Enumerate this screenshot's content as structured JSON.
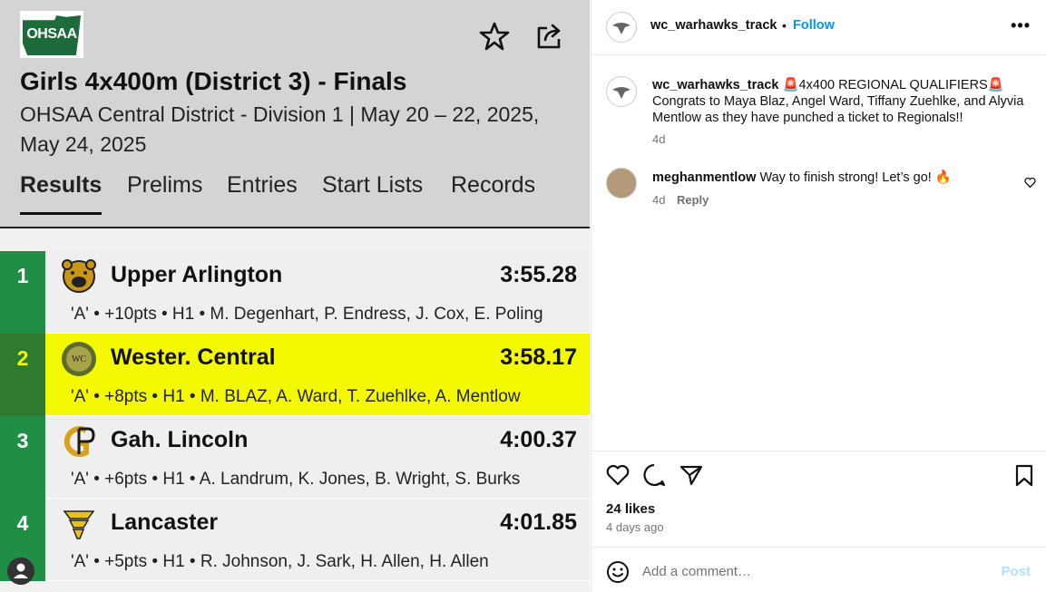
{
  "left": {
    "logo_text": "OHSAA",
    "title": "Girls 4x400m (District 3) - Finals",
    "subtitle": "OHSAA Central District - Division 1 | May 20 – 22, 2025, May 24, 2025",
    "tabs": [
      {
        "label": "Results",
        "active": true
      },
      {
        "label": "Prelims",
        "active": false
      },
      {
        "label": "Entries",
        "active": false
      },
      {
        "label": "Start Lists",
        "active": false
      },
      {
        "label": "Records",
        "active": false
      }
    ],
    "results": [
      {
        "place": "1",
        "team": "Upper Arlington",
        "time": "3:55.28",
        "detail": "'A' • +10pts • H1 • M. Degenhart, P. Endress, J. Cox, E. Poling"
      },
      {
        "place": "2",
        "team": "Wester. Central",
        "time": "3:58.17",
        "detail": "'A' • +8pts • H1 • M. BLAZ, A. Ward, T. Zuehlke, A. Mentlow",
        "highlighted": true
      },
      {
        "place": "3",
        "team": "Gah. Lincoln",
        "time": "4:00.37",
        "detail": "'A' • +6pts • H1 • A. Landrum, K. Jones, B. Wright, S. Burks"
      },
      {
        "place": "4",
        "team": "Lancaster",
        "time": "4:01.85",
        "detail": "'A' • +5pts • H1 • R. Johnson, J. Sark, H. Allen, H. Allen"
      }
    ],
    "colors": {
      "place_green": "#1f8f45",
      "highlight": "#f4f900",
      "header_bg": "#d4d4d4"
    }
  },
  "post": {
    "username": "wc_warhawks_track",
    "dot": "•",
    "follow_label": "Follow",
    "more_label": "•••",
    "caption_user": "wc_warhawks_track",
    "caption_text": "🚨4x400 REGIONAL QUALIFIERS🚨 Congrats to Maya Blaz, Angel Ward, Tiffany Zuehlke, and Alyvia Mentlow as they have punched a ticket to Regionals!!",
    "caption_age": "4d",
    "comment": {
      "user": "meghanmentlow",
      "text": "Way to finish strong! Let’s go! 🔥",
      "age": "4d",
      "reply_label": "Reply"
    },
    "likes": "24 likes",
    "posted": "4 days ago",
    "add_comment_placeholder": "Add a comment…",
    "post_label": "Post"
  }
}
